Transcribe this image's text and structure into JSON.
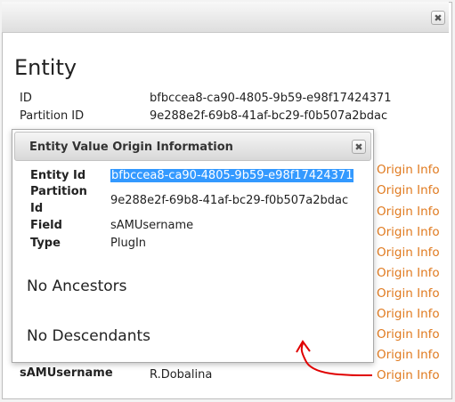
{
  "outer_dialog": {
    "heading": "Entity",
    "rows": [
      {
        "label": "ID",
        "value": "bfbccea8-ca90-4805-9b59-e98f17424371"
      },
      {
        "label": "Partition ID",
        "value": "9e288e2f-69b8-41af-bc29-f0b507a2bdac"
      }
    ],
    "origin_link_label": "Origin Info",
    "last_row": {
      "label": "sAMUsername",
      "value": "R.Dobalina",
      "link": "Origin Info"
    }
  },
  "modal": {
    "title": "Entity Value Origin Information",
    "entity_id_label": "Entity Id",
    "entity_id_value": "bfbccea8-ca90-4805-9b59-e98f17424371",
    "partition_id_label_1": "Partition",
    "partition_id_label_2": "Id",
    "partition_id_value": "9e288e2f-69b8-41af-bc29-f0b507a2bdac",
    "field_label": "Field",
    "field_value": "sAMUsername",
    "type_label": "Type",
    "type_value": "PlugIn",
    "no_ancestors": "No Ancestors",
    "no_descendants": "No Descendants"
  },
  "colors": {
    "link": "#e07a1f",
    "selection": "#3399ff",
    "annotation": "#e00000"
  },
  "icons": {
    "close": "close-icon"
  }
}
